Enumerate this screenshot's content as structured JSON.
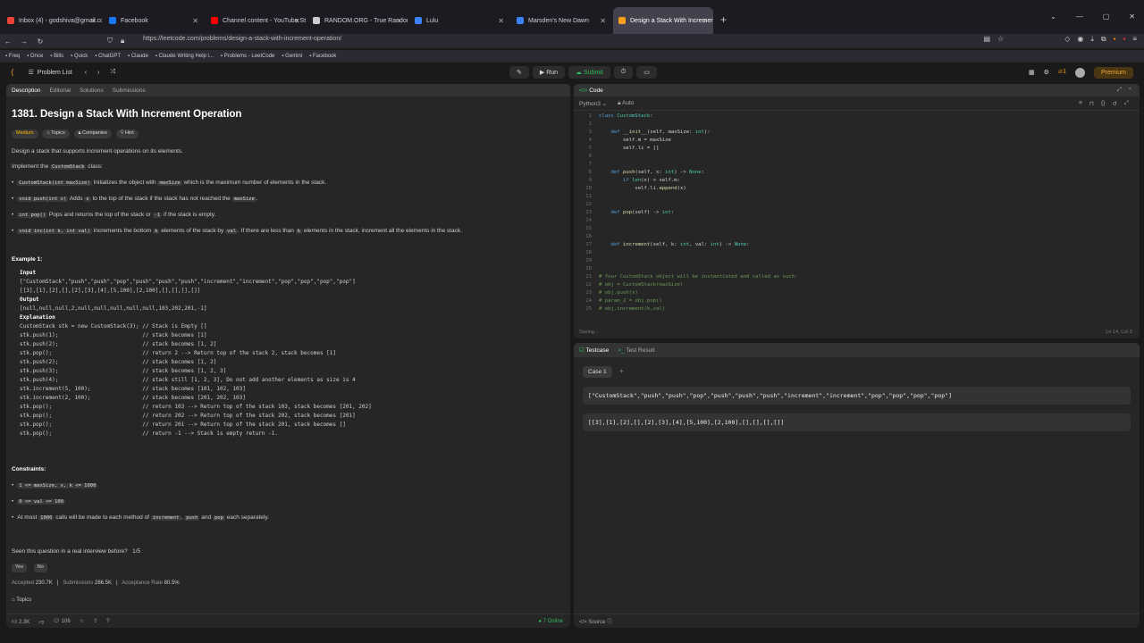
{
  "browser": {
    "tabs": [
      {
        "title": "Inbox (4) - godshiva@gmail.co",
        "color": "#ea4335"
      },
      {
        "title": "Facebook",
        "color": "#1877f2"
      },
      {
        "title": "Channel content - YouTube Stu",
        "color": "#ff0000"
      },
      {
        "title": "RANDOM.ORG - True Random",
        "color": "#cccccc"
      },
      {
        "title": "Lulu",
        "color": "#3b82f6"
      },
      {
        "title": "Marsden's New Dawn",
        "color": "#3b82f6"
      },
      {
        "title": "Design a Stack With Increment",
        "color": "#f89f1b"
      }
    ],
    "url": "https://leetcode.com/problems/design-a-stack-with-increment-operation/",
    "bookmarks": [
      "Freq",
      "Once",
      "Bills",
      "Quick",
      "ChatGPT",
      "Claude",
      "Claude Writing Help i...",
      "Problems - LeetCode",
      "Gemini",
      "Facebook"
    ]
  },
  "header": {
    "problem_list": "Problem List",
    "run": "Run",
    "submit": "Submit",
    "streak": "1",
    "premium": "Premium"
  },
  "description": {
    "tabs": [
      "Description",
      "Editorial",
      "Solutions",
      "Submissions"
    ],
    "title": "1381. Design a Stack With Increment Operation",
    "tags": [
      "Medium",
      "Topics",
      "Companies",
      "Hint"
    ],
    "intro": "Design a stack that supports increment operations on its elements.",
    "implement_pre": "Implement the",
    "implement_code": "CustomStack",
    "implement_post": "class:",
    "m1_code": "CustomStack(int maxSize)",
    "m1_a": "Initializes the object with",
    "m1_code2": "maxSize",
    "m1_b": "which is the maximum number of elements in the stack.",
    "m2_code": "void push(int x)",
    "m2_a": "Adds",
    "m2_code2": "x",
    "m2_b": "to the top of the stack if the stack has not reached the",
    "m2_code3": "maxSize",
    "m3_code": "int pop()",
    "m3_a": "Pops and returns the top of the stack or",
    "m3_code2": "-1",
    "m3_b": "if the stack is empty.",
    "m4_code": "void inc(int k, int val)",
    "m4_a": "Increments the bottom",
    "m4_code2": "k",
    "m4_b": "elements of the stack by",
    "m4_code3": "val",
    "m4_c": ". If there are less than",
    "m4_code4": "k",
    "m4_d": "elements in the stack, increment all the elements in the stack.",
    "example_title": "Example 1:",
    "input_label": "Input",
    "input_l1": "[\"CustomStack\",\"push\",\"push\",\"pop\",\"push\",\"push\",\"push\",\"increment\",\"increment\",\"pop\",\"pop\",\"pop\",\"pop\"]",
    "input_l2": "[[3],[1],[2],[],[2],[3],[4],[5,100],[2,100],[],[],[],[]]",
    "output_label": "Output",
    "output_l1": "[null,null,null,2,null,null,null,null,null,103,202,201,-1]",
    "explanation_label": "Explanation",
    "explanation": [
      "CustomStack stk = new CustomStack(3); // Stack is Empty []",
      "stk.push(1);                          // stack becomes [1]",
      "stk.push(2);                          // stack becomes [1, 2]",
      "stk.pop();                            // return 2 --> Return top of the stack 2, stack becomes [1]",
      "stk.push(2);                          // stack becomes [1, 2]",
      "stk.push(3);                          // stack becomes [1, 2, 3]",
      "stk.push(4);                          // stack still [1, 2, 3], Do not add another elements as size is 4",
      "stk.increment(5, 100);                // stack becomes [101, 102, 103]",
      "stk.increment(2, 100);                // stack becomes [201, 202, 103]",
      "stk.pop();                            // return 103 --> Return top of the stack 103, stack becomes [201, 202]",
      "stk.pop();                            // return 202 --> Return top of the stack 202, stack becomes [201]",
      "stk.pop();                            // return 201 --> Return top of the stack 201, stack becomes []",
      "stk.pop();                            // return -1 --> Stack is empty return -1."
    ],
    "constraints_title": "Constraints:",
    "c1": "1 <= maxSize, x, k <= 1000",
    "c2": "0 <= val <= 100",
    "c3_a": "At most",
    "c3_code": "1000",
    "c3_b": "calls will be made to each method of",
    "c3_code2": "increment",
    "c3_sep": ",",
    "c3_code3": "push",
    "c3_c": "and",
    "c3_code4": "pop",
    "c3_d": "each separately.",
    "seen": "Seen this question in a real interview before?",
    "seen_count": "1/5",
    "yes": "Yes",
    "no": "No",
    "accepted_label": "Accepted",
    "accepted": "230.7K",
    "submissions_label": "Submissions",
    "submissions": "286.5K",
    "rate_label": "Acceptance Rate",
    "rate": "80.5%",
    "likes": "2.3K",
    "comments": "106",
    "online": "7 Online",
    "topics": "Topics"
  },
  "code": {
    "tab": "Code",
    "language": "Python3",
    "auto": "Auto",
    "saving": "Saving...",
    "cursor": "Ln 14, Col 9",
    "lines": [
      "class CustomStack:",
      "",
      "    def __init__(self, maxSize: int):",
      "        self.m = maxSize",
      "        self.li = []",
      "",
      "",
      "    def push(self, x: int) -> None:",
      "        if len(x) < self.m:",
      "            self.li.append(x)",
      "",
      "",
      "    def pop(self) -> int:",
      "",
      "",
      "",
      "    def increment(self, k: int, val: int) -> None:",
      "",
      "",
      "",
      "# Your CustomStack object will be instantiated and called as such:",
      "# obj = CustomStack(maxSize)",
      "# obj.push(x)",
      "# param_2 = obj.pop()",
      "# obj.increment(k,val)"
    ]
  },
  "test": {
    "tabs": [
      "Testcase",
      "Test Result"
    ],
    "case": "Case 1",
    "input1": "[\"CustomStack\",\"push\",\"push\",\"pop\",\"push\",\"push\",\"push\",\"increment\",\"increment\",\"pop\",\"pop\",\"pop\",\"pop\"]",
    "input2": "[[3],[1],[2],[],[2],[3],[4],[5,100],[2,100],[],[],[],[]]",
    "source": "Source"
  }
}
